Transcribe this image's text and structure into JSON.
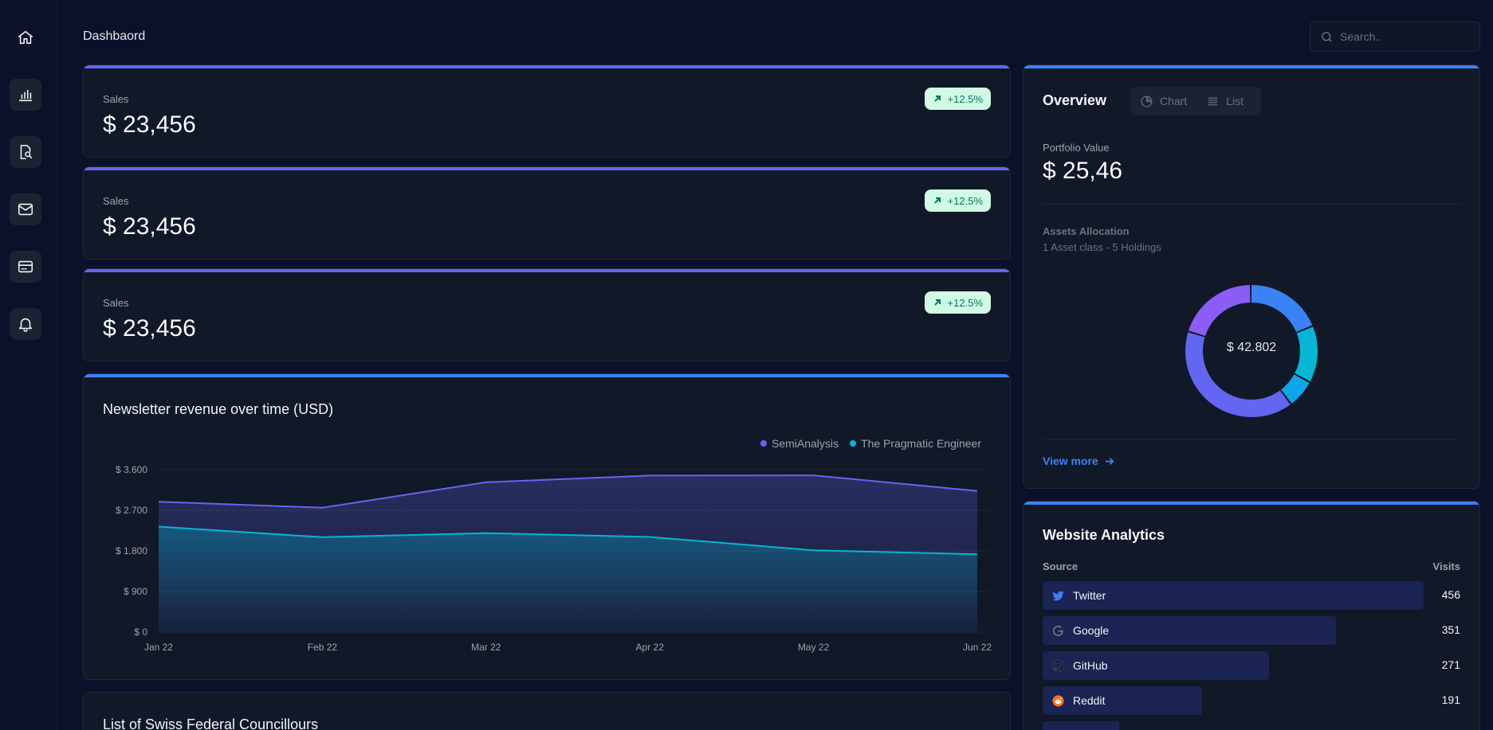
{
  "page": {
    "title": "Dashbaord"
  },
  "search": {
    "placeholder": "Search.."
  },
  "sidebar": {
    "items": [
      {
        "name": "home-icon"
      },
      {
        "name": "bar-chart-icon"
      },
      {
        "name": "document-search-icon"
      },
      {
        "name": "mail-icon"
      },
      {
        "name": "credit-card-icon"
      },
      {
        "name": "bell-icon"
      }
    ]
  },
  "kpis": [
    {
      "label": "Sales",
      "value": "$ 23,456",
      "delta": "+12.5%"
    },
    {
      "label": "Sales",
      "value": "$ 23,456",
      "delta": "+12.5%"
    },
    {
      "label": "Sales",
      "value": "$ 23,456",
      "delta": "+12.5%"
    }
  ],
  "revenue_chart": {
    "title": "Newsletter revenue over time (USD)"
  },
  "chart_data": {
    "type": "area",
    "title": "Newsletter revenue over time (USD)",
    "categories": [
      "Jan 22",
      "Feb 22",
      "Mar 22",
      "Apr 22",
      "May 22",
      "Jun 22"
    ],
    "series": [
      {
        "name": "SemiAnalysis",
        "color": "#6366f1",
        "values": [
          2890,
          2756,
          3322,
          3470,
          3475,
          3129
        ]
      },
      {
        "name": "The Pragmatic Engineer",
        "color": "#06b6d4",
        "values": [
          2338,
          2103,
          2194,
          2108,
          1812,
          1726
        ]
      }
    ],
    "yticks": [
      "$ 0",
      "$ 900",
      "$ 1.800",
      "$ 2.700",
      "$ 3.600"
    ],
    "ylim": [
      0,
      3600
    ],
    "legend": "top-right",
    "grid": true
  },
  "overview": {
    "title": "Overview",
    "toggle": {
      "chart_label": "Chart",
      "list_label": "List"
    },
    "portfolio_label": "Portfolio Value",
    "portfolio_value": "$ 25,46",
    "allocation_title": "Assets Allocation",
    "allocation_sub": "1 Asset class - 5 Holdings",
    "donut_center": "$ 42.802",
    "donut": [
      {
        "value": 0.19,
        "color": "#3b82f6"
      },
      {
        "value": 0.14,
        "color": "#06b6d4"
      },
      {
        "value": 0.07,
        "color": "#0ea5e9"
      },
      {
        "value": 0.4,
        "color": "#6366f1"
      },
      {
        "value": 0.2,
        "color": "#8b5cf6"
      }
    ],
    "view_more": "View more"
  },
  "analytics": {
    "title": "Website Analytics",
    "col_source": "Source",
    "col_visits": "Visits",
    "rows": [
      {
        "source": "Twitter",
        "visits": "456",
        "icon": "twitter-icon",
        "share": 1.0
      },
      {
        "source": "Google",
        "visits": "351",
        "icon": "google-icon",
        "share": 0.77
      },
      {
        "source": "GitHub",
        "visits": "271",
        "icon": "github-icon",
        "share": 0.594
      },
      {
        "source": "Reddit",
        "visits": "191",
        "icon": "reddit-icon",
        "share": 0.419
      }
    ]
  },
  "councillors": {
    "title": "List of Swiss Federal Councillours"
  }
}
